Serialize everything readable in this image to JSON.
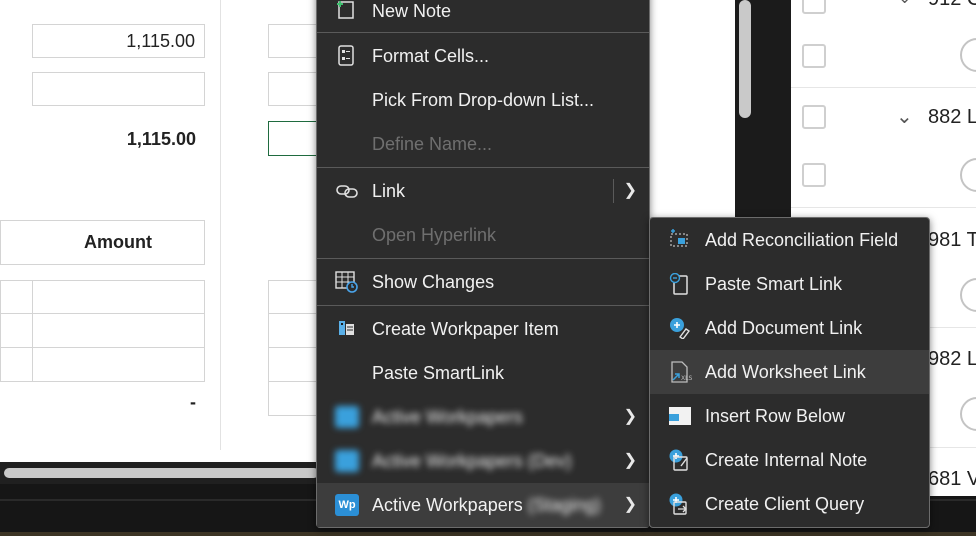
{
  "sheet": {
    "values": {
      "v1": "1,115.00",
      "total": "1,115.00",
      "amount_header": "Amount",
      "dash": "-"
    }
  },
  "right_pane": {
    "rows": [
      {
        "label": "912 C"
      },
      {
        "label": "882 L"
      },
      {
        "label": "981 T"
      },
      {
        "label": "982 L"
      },
      {
        "label": "681 V"
      }
    ]
  },
  "context_menu": {
    "items": [
      {
        "label": "New Note",
        "icon": "new-note-icon"
      },
      {
        "label": "Format Cells...",
        "icon": "format-cells-icon"
      },
      {
        "label": "Pick From Drop-down List..."
      },
      {
        "label": "Define Name...",
        "disabled": true
      },
      {
        "label": "Link",
        "icon": "link-icon",
        "submenu": true
      },
      {
        "label": "Open Hyperlink",
        "disabled": true
      },
      {
        "label": "Show Changes",
        "icon": "show-changes-icon"
      },
      {
        "label": "Create Workpaper Item",
        "icon": "workpaper-item-icon"
      },
      {
        "label": "Paste SmartLink"
      },
      {
        "label": "Active Workpapers",
        "icon": "active-workpapers-icon",
        "submenu": true
      },
      {
        "label": "Active Workpapers (Dev)",
        "icon": "active-workpapers-icon",
        "submenu": true
      },
      {
        "label": "Active Workpapers",
        "suffix": "(Staging)",
        "badge": "Wp",
        "submenu": true
      }
    ]
  },
  "submenu": {
    "items": [
      {
        "label": "Add Reconciliation Field",
        "icon": "reconciliation-field-icon"
      },
      {
        "label": "Paste Smart Link",
        "icon": "paste-smart-link-icon"
      },
      {
        "label": "Add Document Link",
        "icon": "document-link-icon"
      },
      {
        "label": "Add Worksheet Link",
        "icon": "worksheet-link-icon",
        "highlighted": true
      },
      {
        "label": "Insert Row Below",
        "icon": "insert-row-icon"
      },
      {
        "label": "Create Internal Note",
        "icon": "internal-note-icon"
      },
      {
        "label": "Create Client Query",
        "icon": "client-query-icon"
      }
    ]
  },
  "colors": {
    "accent_blue": "#1e88d6",
    "menu_bg": "#2c2c2c",
    "selection_green": "#1f6b3f"
  }
}
